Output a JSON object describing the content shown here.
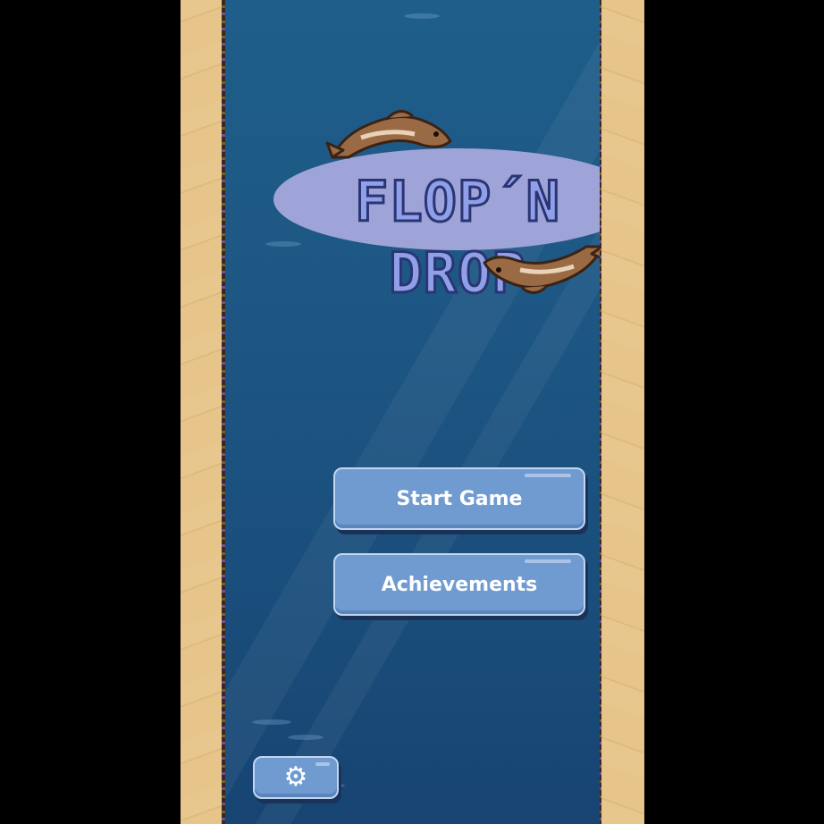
{
  "game": {
    "title": "FLOP´N DROP",
    "buttons": {
      "start_label": "Start Game",
      "achievements_label": "Achievements"
    },
    "settings_icon": "gear-icon",
    "settings_glyph": "⚙"
  },
  "colors": {
    "water": "#1d5683",
    "sand": "#e8c78e",
    "button": "#6f9bd0",
    "title_fill": "#8fa0e8",
    "title_outline": "#2b3574",
    "logo_ellipse": "#9ea3d8",
    "fish": "#9a6a45"
  }
}
